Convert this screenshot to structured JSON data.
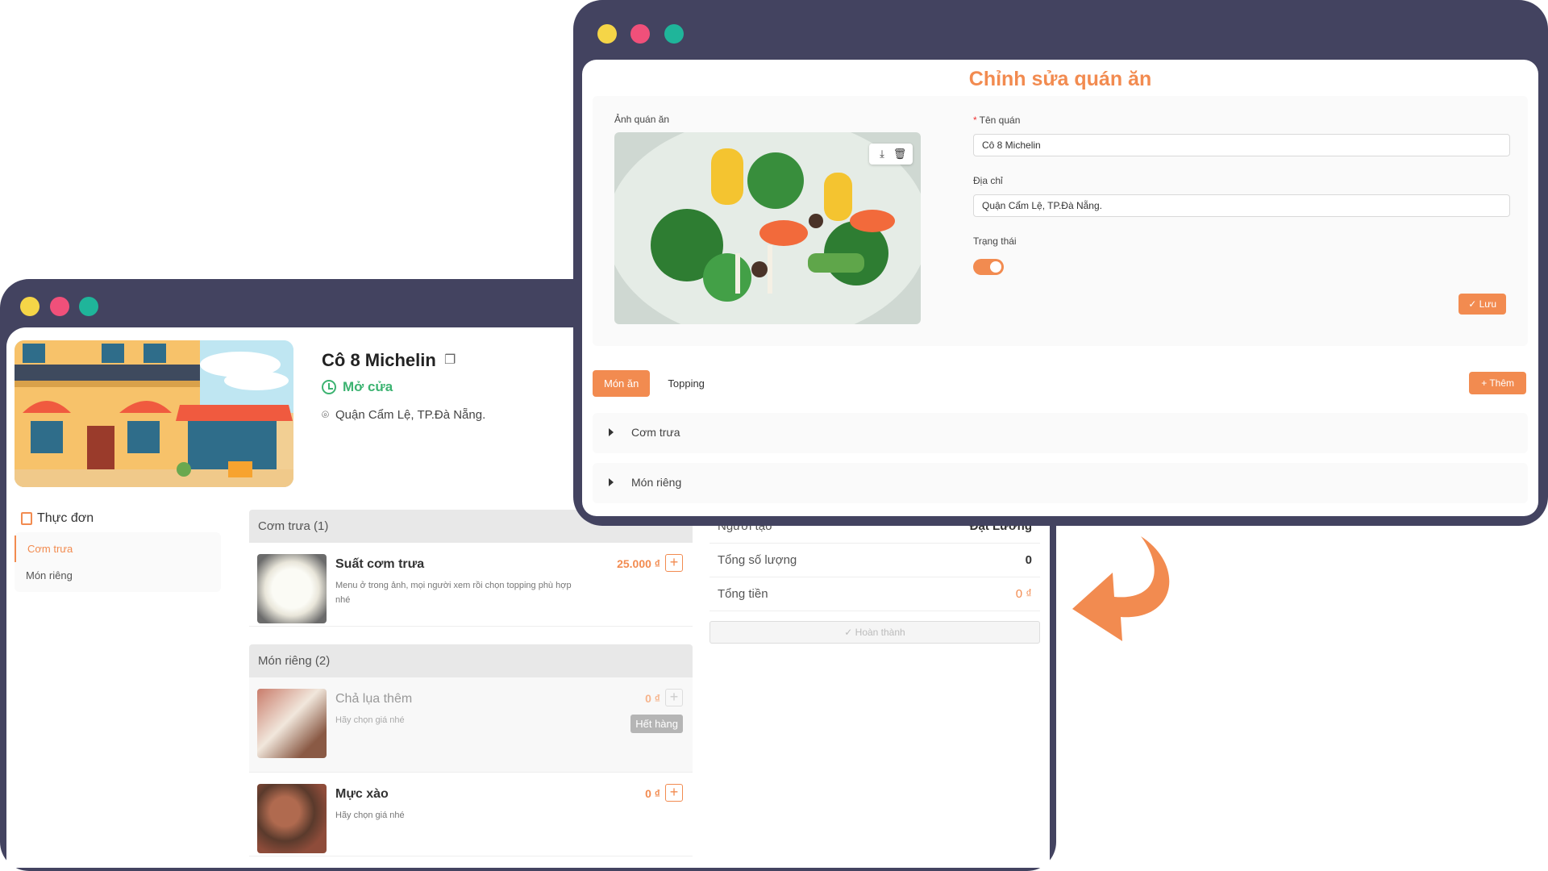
{
  "colors": {
    "accent": "#f28b50",
    "frame": "#434360",
    "dot_yellow": "#f5d547",
    "dot_pink": "#f0507a",
    "dot_green": "#1fb59a",
    "status_green": "#3cb371"
  },
  "shop": {
    "name": "Cô 8 Michelin",
    "status": "Mở cửa",
    "address": "Quận Cẩm Lệ, TP.Đà Nẵng."
  },
  "menu": {
    "title": "Thực đơn",
    "items": [
      "Cơm trưa",
      "Món riêng"
    ]
  },
  "categories": [
    {
      "header": "Cơm trưa (1)",
      "items": [
        {
          "name": "Suất cơm trưa",
          "desc": "Menu ở trong ảnh, mọi người xem rồi chọn topping phù hợp nhé",
          "price": "25.000 ₫"
        }
      ]
    },
    {
      "header": "Món riêng (2)",
      "items": [
        {
          "name": "Chả lụa thêm",
          "desc": "Hãy chọn giá nhé",
          "price": "0 ₫",
          "badge": "Hết hàng"
        },
        {
          "name": "Mực xào",
          "desc": "Hãy chọn giá nhé",
          "price": "0 ₫"
        }
      ]
    }
  ],
  "summary": {
    "creator_label": "Người tạo",
    "creator_value": "Đạt Lương",
    "qty_label": "Tổng số lượng",
    "qty_value": "0",
    "total_label": "Tổng tiền",
    "total_value": "0 ₫",
    "done_label": "✓ Hoàn thành"
  },
  "edit": {
    "title": "Chỉnh sửa quán ăn",
    "photo_label": "Ảnh quán ăn",
    "name_label": "Tên quán",
    "name_value": "Cô 8 Michelin",
    "address_label": "Địa chỉ",
    "address_value": "Quận Cẩm Lệ,  TP.Đà Nẵng.",
    "status_label": "Trạng thái",
    "status_on": true,
    "save_label": "✓ Lưu",
    "tabs": [
      "Món ăn",
      "Topping"
    ],
    "add_label": "+ Thêm",
    "sections": [
      "Cơm trưa",
      "Món riêng"
    ]
  },
  "icons": [
    "copy-icon",
    "clock-icon",
    "location-pin-icon",
    "menu-icon",
    "plus-icon",
    "upload-icon",
    "trash-icon",
    "check-icon",
    "caret-right-icon",
    "curved-arrow-icon"
  ]
}
